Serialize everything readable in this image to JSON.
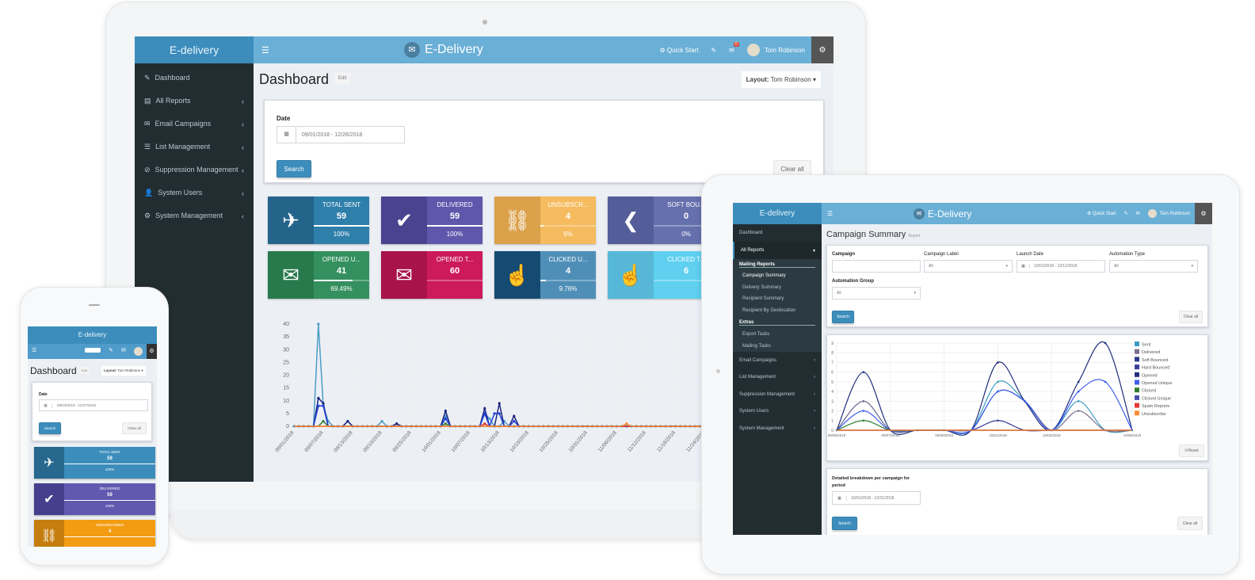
{
  "brand": {
    "name": "E-delivery",
    "title": "E-Delivery"
  },
  "laptop": {
    "header": {
      "quick_start": "Quick Start",
      "mail_badge": "0",
      "user": "Tom Robinson"
    },
    "sidebar": [
      {
        "label": "Dashboard",
        "icon": "wrench-icon"
      },
      {
        "label": "All Reports",
        "icon": "table-icon"
      },
      {
        "label": "Email Campaigns",
        "icon": "envelope-icon"
      },
      {
        "label": "List Management",
        "icon": "list-icon"
      },
      {
        "label": "Suppression Management",
        "icon": "ban-icon"
      },
      {
        "label": "System Users",
        "icon": "user-icon"
      },
      {
        "label": "System Management",
        "icon": "cogs-icon"
      }
    ],
    "page_title": "Dashboard",
    "edit_label": "Edit",
    "layout_label": "Layout:",
    "layout_value": "Tom Robinson",
    "date_label": "Date",
    "date_value": "09/01/2018 - 12/26/2018",
    "search": "Search",
    "clear": "Clear all",
    "cards": [
      {
        "title": "TOTAL SENT",
        "value": "59",
        "pct": "100%",
        "fill": 100,
        "color": "#2f7fab",
        "dark": "#24648a",
        "icon": "paper-plane-icon"
      },
      {
        "title": "DELIVERED",
        "value": "59",
        "pct": "100%",
        "fill": 100,
        "color": "#5f57ab",
        "dark": "#4a4390",
        "icon": "check-icon"
      },
      {
        "title": "UNSUBSCR...",
        "value": "4",
        "pct": "6%",
        "fill": 6,
        "color": "#f5bb5e",
        "dark": "#dba14a",
        "icon": "unlink-icon"
      },
      {
        "title": "SOFT BOU...",
        "value": "0",
        "pct": "0%",
        "fill": 0,
        "color": "#6670ad",
        "dark": "#545d99",
        "icon": "chevron-left-circle-icon"
      },
      {
        "title": "OPENED U...",
        "value": "41",
        "pct": "69.49%",
        "fill": 69.49,
        "color": "#34905e",
        "dark": "#287a4d",
        "icon": "envelope-open-icon"
      },
      {
        "title": "OPENED T...",
        "value": "60",
        "pct": "",
        "fill": null,
        "color": "#cc1a5a",
        "dark": "#a81349",
        "icon": "envelope-open-icon"
      },
      {
        "title": "CLICKED U...",
        "value": "4",
        "pct": "9.76%",
        "fill": 9.76,
        "color": "#4f8fb7",
        "dark": "#154a72",
        "icon": "hand-pointer-icon"
      },
      {
        "title": "CLICKED T...",
        "value": "6",
        "pct": "",
        "fill": null,
        "color": "#5fd0ef",
        "dark": "#56b8d6",
        "icon": "hand-pointer-icon"
      }
    ]
  },
  "chart_data": [
    {
      "type": "line",
      "ylim": [
        0,
        40
      ],
      "yticks": [
        0,
        5,
        10,
        15,
        20,
        25,
        30,
        35,
        40
      ],
      "x_start": "09/01/2018",
      "x_end": "12/20/2018",
      "xticks": [
        "09/01/2018",
        "09/07/2018",
        "09/13/2018",
        "09/19/2018",
        "09/25/2018",
        "10/01/2018",
        "10/07/2018",
        "10/13/2018",
        "10/19/2018",
        "10/25/2018",
        "10/31/2018",
        "11/06/2018",
        "11/12/2018",
        "11/18/2018",
        "11/24/2018",
        "11/30/2018",
        "12/06/2018",
        "12/12/2018",
        "12/18/2018"
      ],
      "series": [
        {
          "color": "#4d9cc8",
          "points": [
            [
              "09/06/2018",
              40
            ],
            [
              "09/07/2018",
              8
            ],
            [
              "09/08/2018",
              2
            ],
            [
              "09/12/2018",
              2
            ],
            [
              "09/19/2018",
              2
            ],
            [
              "09/22/2018",
              1
            ],
            [
              "10/02/2018",
              4
            ],
            [
              "10/10/2018",
              5
            ],
            [
              "10/11/2018",
              3
            ],
            [
              "10/14/2018",
              2
            ]
          ]
        },
        {
          "color": "#1a237e",
          "points": [
            [
              "09/06/2018",
              11
            ],
            [
              "09/07/2018",
              9
            ],
            [
              "09/12/2018",
              2
            ],
            [
              "09/22/2018",
              1
            ],
            [
              "10/02/2018",
              6
            ],
            [
              "10/10/2018",
              7
            ],
            [
              "10/13/2018",
              9
            ],
            [
              "10/16/2018",
              4
            ]
          ]
        },
        {
          "color": "#2140d8",
          "points": [
            [
              "09/06/2018",
              8
            ],
            [
              "09/07/2018",
              8
            ],
            [
              "10/02/2018",
              3
            ],
            [
              "10/10/2018",
              5
            ],
            [
              "10/12/2018",
              5
            ],
            [
              "10/13/2018",
              5
            ],
            [
              "10/16/2018",
              2
            ]
          ]
        },
        {
          "color": "#2e7d32",
          "points": [
            [
              "09/07/2018",
              2
            ],
            [
              "10/02/2018",
              1
            ]
          ]
        },
        {
          "color": "#e53935",
          "points": [
            [
              "10/10/2018",
              1
            ]
          ]
        },
        {
          "color": "#ff8a33",
          "points": [
            [
              "11/08/2018",
              1
            ]
          ]
        }
      ]
    },
    {
      "type": "line",
      "ylim": [
        0,
        9
      ],
      "yticks": [
        0,
        1,
        2,
        3,
        4,
        5,
        6,
        7,
        8,
        9
      ],
      "categories": [
        "09/05/2018",
        "",
        "09/07/2018",
        "",
        "09/09/2018",
        "",
        "10/01/2018",
        "",
        "10/03/2018",
        "",
        "",
        "10/06/2018"
      ],
      "series": [
        {
          "name": "Sent",
          "color": "#3c9dc4",
          "values": [
            0,
            3,
            0,
            0,
            0,
            0,
            5,
            3,
            0,
            3,
            0,
            0
          ]
        },
        {
          "name": "Delivered",
          "color": "#7a6f8f",
          "values": [
            0,
            3,
            0,
            0,
            0,
            0,
            4,
            3,
            0,
            2,
            0,
            0
          ]
        },
        {
          "name": "Soft Bounced",
          "color": "#2d3a8c",
          "values": [
            0,
            0,
            0,
            0,
            0,
            0,
            0,
            0,
            0,
            0,
            0,
            0
          ]
        },
        {
          "name": "Hard Bounced",
          "color": "#3a3f9a",
          "values": [
            0,
            0,
            0,
            0,
            0,
            0,
            1,
            0,
            0,
            0,
            0,
            0
          ]
        },
        {
          "name": "Opened",
          "color": "#1f2d7a",
          "values": [
            0,
            6,
            0,
            0,
            0,
            0,
            7,
            3,
            0,
            5,
            9,
            0
          ]
        },
        {
          "name": "Opened Unique",
          "color": "#3d5ef0",
          "values": [
            0,
            2,
            0,
            0,
            0,
            0,
            4,
            3,
            0,
            4,
            5,
            0
          ]
        },
        {
          "name": "Clicked",
          "color": "#2e7d32",
          "values": [
            0,
            1,
            0,
            0,
            0,
            0,
            0,
            0,
            0,
            0,
            0,
            0
          ]
        },
        {
          "name": "Clicked Unique",
          "color": "#4a4fb0",
          "values": [
            0,
            0,
            0,
            0,
            0,
            0,
            0,
            0,
            0,
            0,
            0,
            0
          ]
        },
        {
          "name": "Spam Reports",
          "color": "#e53935",
          "values": [
            0,
            0,
            0,
            0,
            0,
            0,
            0,
            0,
            0,
            0,
            0,
            0
          ]
        },
        {
          "name": "Unsubscribe",
          "color": "#ff8a33",
          "values": [
            0,
            0,
            0,
            0,
            0,
            0,
            0,
            0,
            0,
            0,
            0,
            0
          ]
        }
      ]
    }
  ],
  "tablet": {
    "header": {
      "quick_start": "Quick Start",
      "user": "Tom Robinson"
    },
    "sidebar": {
      "dashboard": "Dashboard",
      "all_reports": "All Reports",
      "mailing_reports": "Mailing Reports",
      "mailing_items": [
        "Campaign Summary",
        "Delivery Summary",
        "Recipient Summary",
        "Recipient By Geolocation"
      ],
      "extras": "Extras",
      "extras_items": [
        "Export Tasks",
        "Mailing Tasks"
      ],
      "bottom": [
        "Email Campaigns",
        "List Management",
        "Suppression Management",
        "System Users",
        "System Management"
      ]
    },
    "page_title": "Campaign Summary",
    "page_sub": "Report",
    "filters": {
      "campaign": "Campaign",
      "campaign_label": "Campaign Label",
      "campaign_label_value": "All",
      "launch_date": "Launch Date",
      "launch_date_value": "10/01/2018 - 12/12/2018",
      "automation_type": "Automation Type",
      "automation_type_value": "All",
      "automation_group": "Automation Group",
      "automation_group_value": "All"
    },
    "search": "Search",
    "clear": "Clear all",
    "reset": "Reset",
    "breakdown_label": "Detailed breakdown per campaign for period",
    "breakdown_date": "10/01/2018 - 12/31/2018"
  },
  "phone": {
    "page_title": "Dashboard",
    "edit": "Edit",
    "layout_label": "Layout:",
    "layout_value": "Tom Robinson",
    "date_label": "Date",
    "date_value": "09/04/2018 - 12/27/2018",
    "search": "Search",
    "clear": "Clear all",
    "cards": [
      {
        "title": "TOTAL SENT",
        "value": "59",
        "pct": "100%"
      },
      {
        "title": "DELIVERED",
        "value": "59",
        "pct": "100%"
      },
      {
        "title": "UNSUBSCRIBED",
        "value": "4"
      }
    ]
  }
}
